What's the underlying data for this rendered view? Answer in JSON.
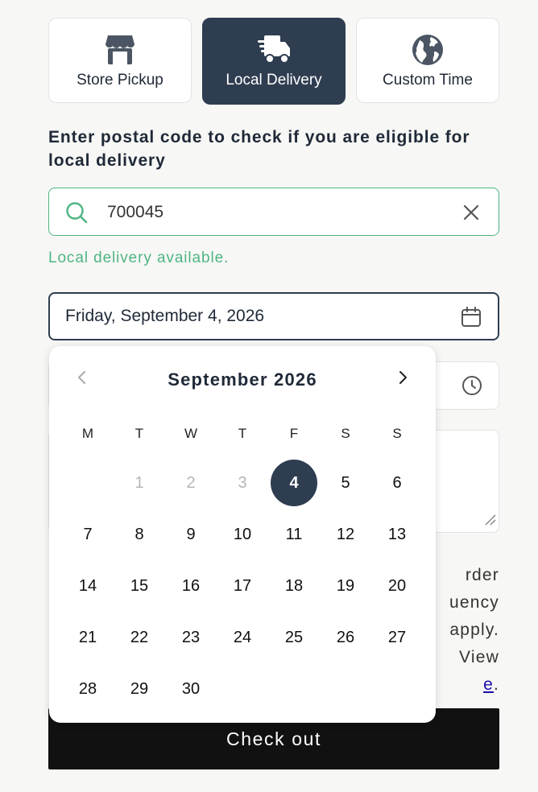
{
  "tabs": [
    {
      "label": "Store Pickup",
      "icon": "store-icon",
      "active": false
    },
    {
      "label": "Local Delivery",
      "icon": "delivery-truck-icon",
      "active": true
    },
    {
      "label": "Custom Time",
      "icon": "globe-icon",
      "active": false
    }
  ],
  "heading_line1": "Enter postal code to check if you are eligible for",
  "heading_line2": "local delivery",
  "search": {
    "value": "700045",
    "icon": "search-icon",
    "clear_icon": "close-icon"
  },
  "availability": "Local delivery available.",
  "date_field": {
    "value": "Friday, September 4, 2026",
    "icon": "calendar-icon"
  },
  "time_field": {
    "icon": "clock-icon"
  },
  "policy": {
    "line1": "rder",
    "line2": "uency",
    "line3": "apply.",
    "line4": "View",
    "link": "e",
    "period": "."
  },
  "checkout_label": "Check out",
  "calendar": {
    "month_label": "September 2026",
    "weekdays": [
      "M",
      "T",
      "W",
      "T",
      "F",
      "S",
      "S"
    ],
    "days": [
      [
        null,
        "1",
        "2",
        "3",
        "4",
        "5",
        "6"
      ],
      [
        "7",
        "8",
        "9",
        "10",
        "11",
        "12",
        "13"
      ],
      [
        "14",
        "15",
        "16",
        "17",
        "18",
        "19",
        "20"
      ],
      [
        "21",
        "22",
        "23",
        "24",
        "25",
        "26",
        "27"
      ],
      [
        "28",
        "29",
        "30",
        null,
        null,
        null,
        null
      ]
    ],
    "disabled_days": [
      "1",
      "2",
      "3"
    ],
    "selected_day": "4",
    "accent_color": "#2f3d51"
  },
  "colors": {
    "success": "#4fb583",
    "dark": "#2f3d51"
  }
}
